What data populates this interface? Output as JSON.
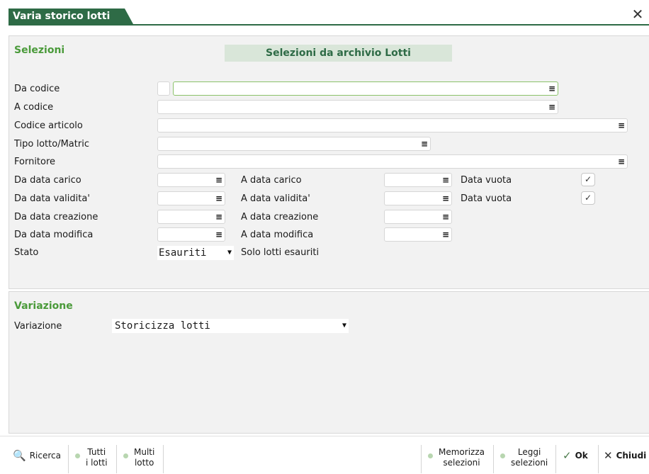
{
  "window": {
    "title": "Varia storico lotti",
    "close_icon": "close-icon"
  },
  "selezioni": {
    "section_title": "Selezioni",
    "header": "Selezioni da archivio Lotti",
    "fields": {
      "da_codice": {
        "label": "Da codice",
        "value": ""
      },
      "a_codice": {
        "label": "A codice",
        "value": ""
      },
      "codice_articolo": {
        "label": "Codice articolo",
        "value": ""
      },
      "tipo_lotto": {
        "label": "Tipo lotto/Matric",
        "value": ""
      },
      "fornitore": {
        "label": "Fornitore",
        "value": ""
      },
      "da_data_carico": {
        "label": "Da data carico",
        "value": ""
      },
      "a_data_carico": {
        "label": "A data carico",
        "value": ""
      },
      "data_vuota_1": {
        "label": "Data vuota",
        "checked": true
      },
      "da_data_validita": {
        "label": "Da data validita'",
        "value": ""
      },
      "a_data_validita": {
        "label": "A data validita'",
        "value": ""
      },
      "data_vuota_2": {
        "label": "Data vuota",
        "checked": true
      },
      "da_data_creazione": {
        "label": "Da data creazione",
        "value": ""
      },
      "a_data_creazione": {
        "label": "A data creazione",
        "value": ""
      },
      "da_data_modifica": {
        "label": "Da data modifica",
        "value": ""
      },
      "a_data_modifica": {
        "label": "A data modifica",
        "value": ""
      },
      "stato": {
        "label": "Stato",
        "selected": "Esauriti",
        "description": "Solo lotti esauriti"
      }
    }
  },
  "variazione": {
    "section_title": "Variazione",
    "label": "Variazione",
    "selected": "Storicizza lotti"
  },
  "toolbar": {
    "ricerca": "Ricerca",
    "tutti_1": "Tutti",
    "tutti_2": "i lotti",
    "multi_1": "Multi",
    "multi_2": "lotto",
    "memorizza_1": "Memorizza",
    "memorizza_2": "selezioni",
    "leggi_1": "Leggi",
    "leggi_2": "selezioni",
    "ok": "Ok",
    "chiudi": "Chiudi"
  },
  "colors": {
    "brand": "#2e6b46",
    "section": "#4a9a3a",
    "header_bg": "#d9e6d9",
    "focus": "#8bc26a"
  }
}
